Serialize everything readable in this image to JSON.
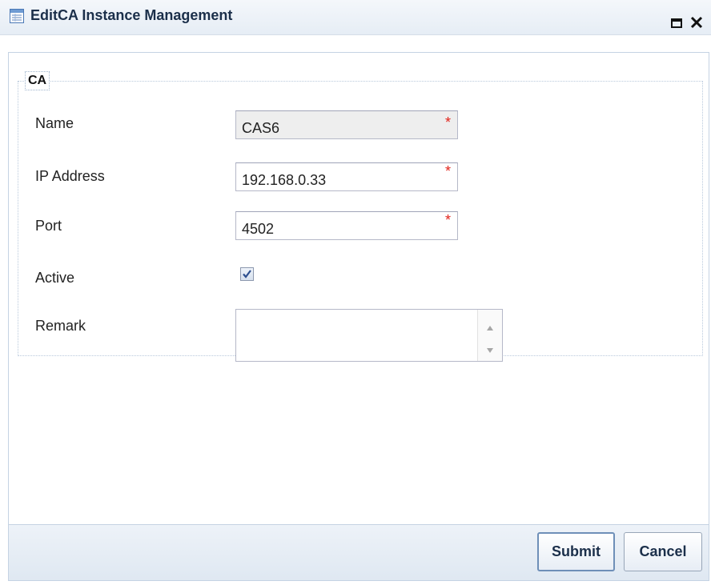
{
  "window": {
    "title": "EditCA Instance Management",
    "icons": {
      "title": "form-icon",
      "maximize": "maximize-icon",
      "close": "close-icon"
    }
  },
  "form": {
    "section_label": "CA",
    "fields": {
      "name": {
        "label": "Name",
        "value": "CAS6",
        "required": "*",
        "readonly": true
      },
      "ip_address": {
        "label": "IP Address",
        "value": "192.168.0.33",
        "required": "*"
      },
      "port": {
        "label": "Port",
        "value": "4502",
        "required": "*"
      },
      "active": {
        "label": "Active",
        "checked": true
      },
      "remark": {
        "label": "Remark",
        "value": ""
      }
    }
  },
  "footer": {
    "submit_label": "Submit",
    "cancel_label": "Cancel"
  },
  "colors": {
    "title_text": "#1b2f4a",
    "required_star": "#e2231a",
    "checkbox_check": "#2d4f8f"
  }
}
